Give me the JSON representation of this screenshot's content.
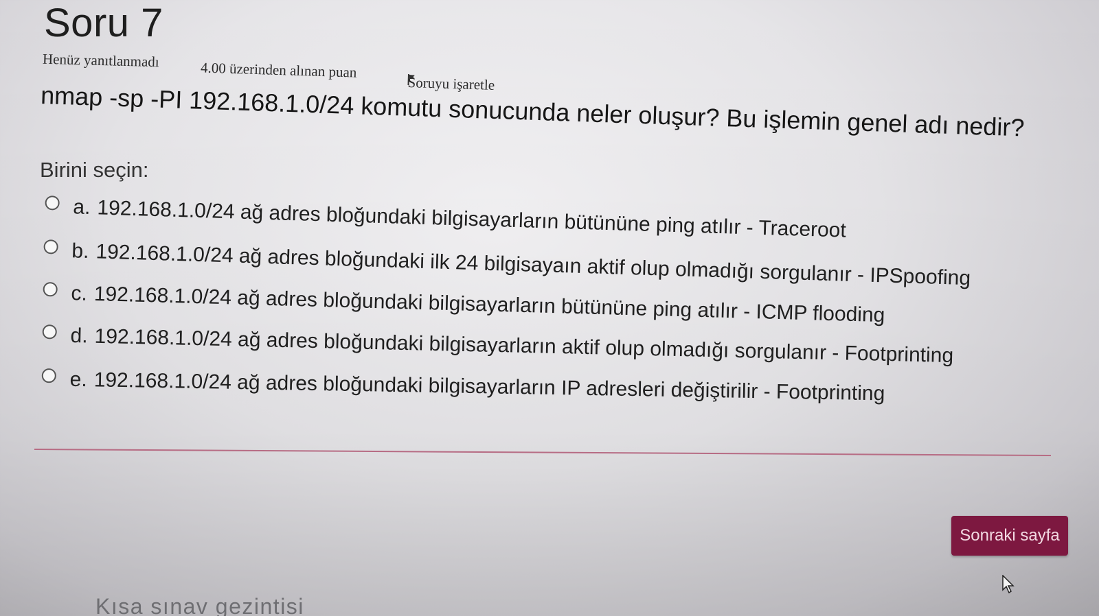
{
  "question": {
    "title": "Soru 7",
    "status": "Henüz yanıtlanmadı",
    "score": "4.00 üzerinden alınan puan",
    "flag_label": "Soruyu işaretle",
    "text": "nmap -sp -PI 192.168.1.0/24 komutu sonucunda neler oluşur? Bu işlemin genel adı nedir?",
    "prompt": "Birini seçin:"
  },
  "answers": [
    {
      "letter": "a.",
      "text": "192.168.1.0/24 ağ adres bloğundaki bilgisayarların bütününe ping atılır - Traceroot"
    },
    {
      "letter": "b.",
      "text": "192.168.1.0/24 ağ adres bloğundaki ilk 24 bilgisayaın aktif olup olmadığı sorgulanır - IPSpoofing"
    },
    {
      "letter": "c.",
      "text": "192.168.1.0/24 ağ adres bloğundaki bilgisayarların bütününe ping atılır - ICMP flooding"
    },
    {
      "letter": "d.",
      "text": "192.168.1.0/24 ağ adres bloğundaki bilgisayarların aktif olup olmadığı sorgulanır - Footprinting"
    },
    {
      "letter": "e.",
      "text": "192.168.1.0/24 ağ adres bloğundaki bilgisayarların IP adresleri değiştirilir - Footprinting"
    }
  ],
  "navigation": {
    "next_label": "Sonraki sayfa",
    "quiz_nav_label": "Kısa sınav gezintisi"
  },
  "colors": {
    "accent": "#7d1840",
    "divider": "#b76c84"
  },
  "icons": {
    "flag": "flag-icon",
    "radio": "radio-icon",
    "cursor": "mouse-pointer-icon"
  }
}
